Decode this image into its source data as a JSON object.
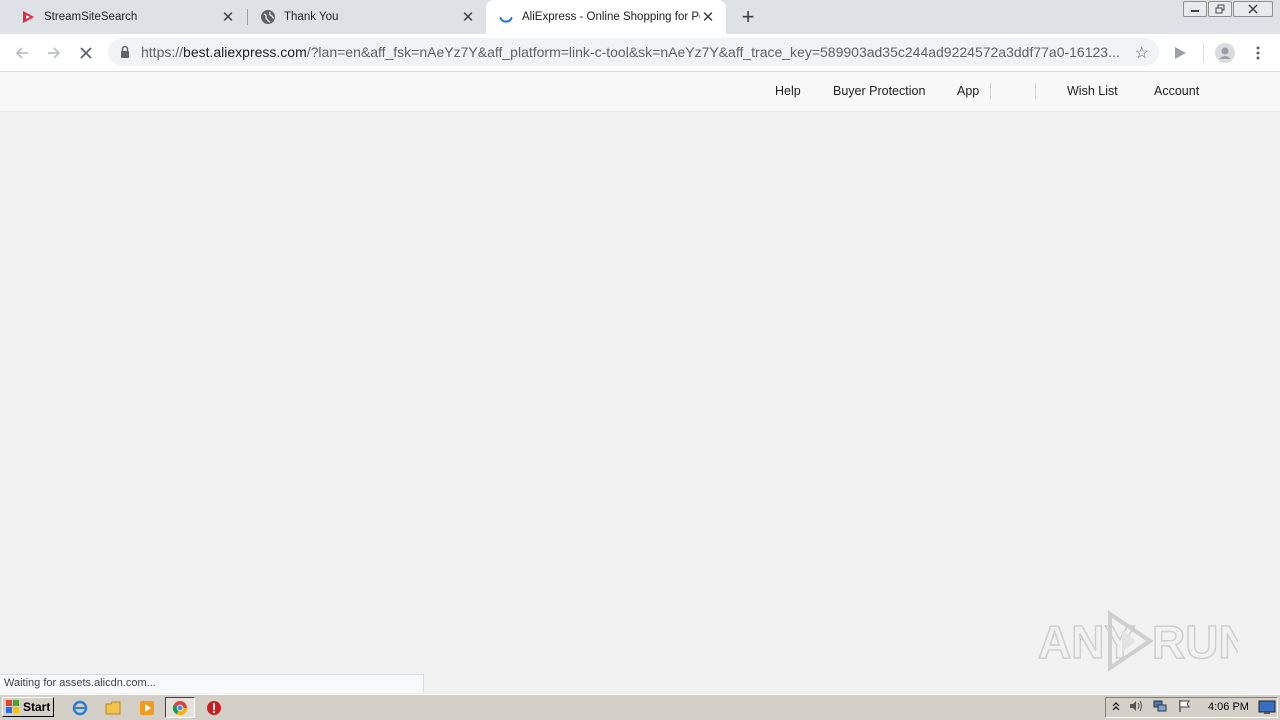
{
  "tabs": [
    {
      "title": "StreamSiteSearch",
      "icon": "streamsitesearch-icon"
    },
    {
      "title": "Thank You",
      "icon": "globe-icon"
    },
    {
      "title": "AliExpress - Online Shopping for Popular Electronics",
      "icon": "loading-spinner-icon",
      "active": true
    }
  ],
  "toolbar": {
    "url_scheme": "https://",
    "url_host": "best.aliexpress.com",
    "url_rest": "/?lan=en&aff_fsk=nAeYz7Y&aff_platform=link-c-tool&sk=nAeYz7Y&aff_trace_key=589903ad35c244ad9224572a3ddf77a0-16123..."
  },
  "site_header": {
    "links": [
      "Help",
      "Buyer Protection",
      "App",
      "Wish List",
      "Account"
    ]
  },
  "status_bubble": "Waiting for assets.alicdn.com...",
  "watermark": "ANY RUN",
  "taskbar": {
    "start_label": "Start",
    "clock": "4:06 PM"
  },
  "colors": {
    "tab_strip": "#dee1e6",
    "page_background": "#f2f2f2",
    "header_background": "#f8f8f8",
    "taskbar": "#d4d0c8",
    "spinner_blue": "#1a73e8",
    "streamsitesearch_red": "#e8253a"
  }
}
